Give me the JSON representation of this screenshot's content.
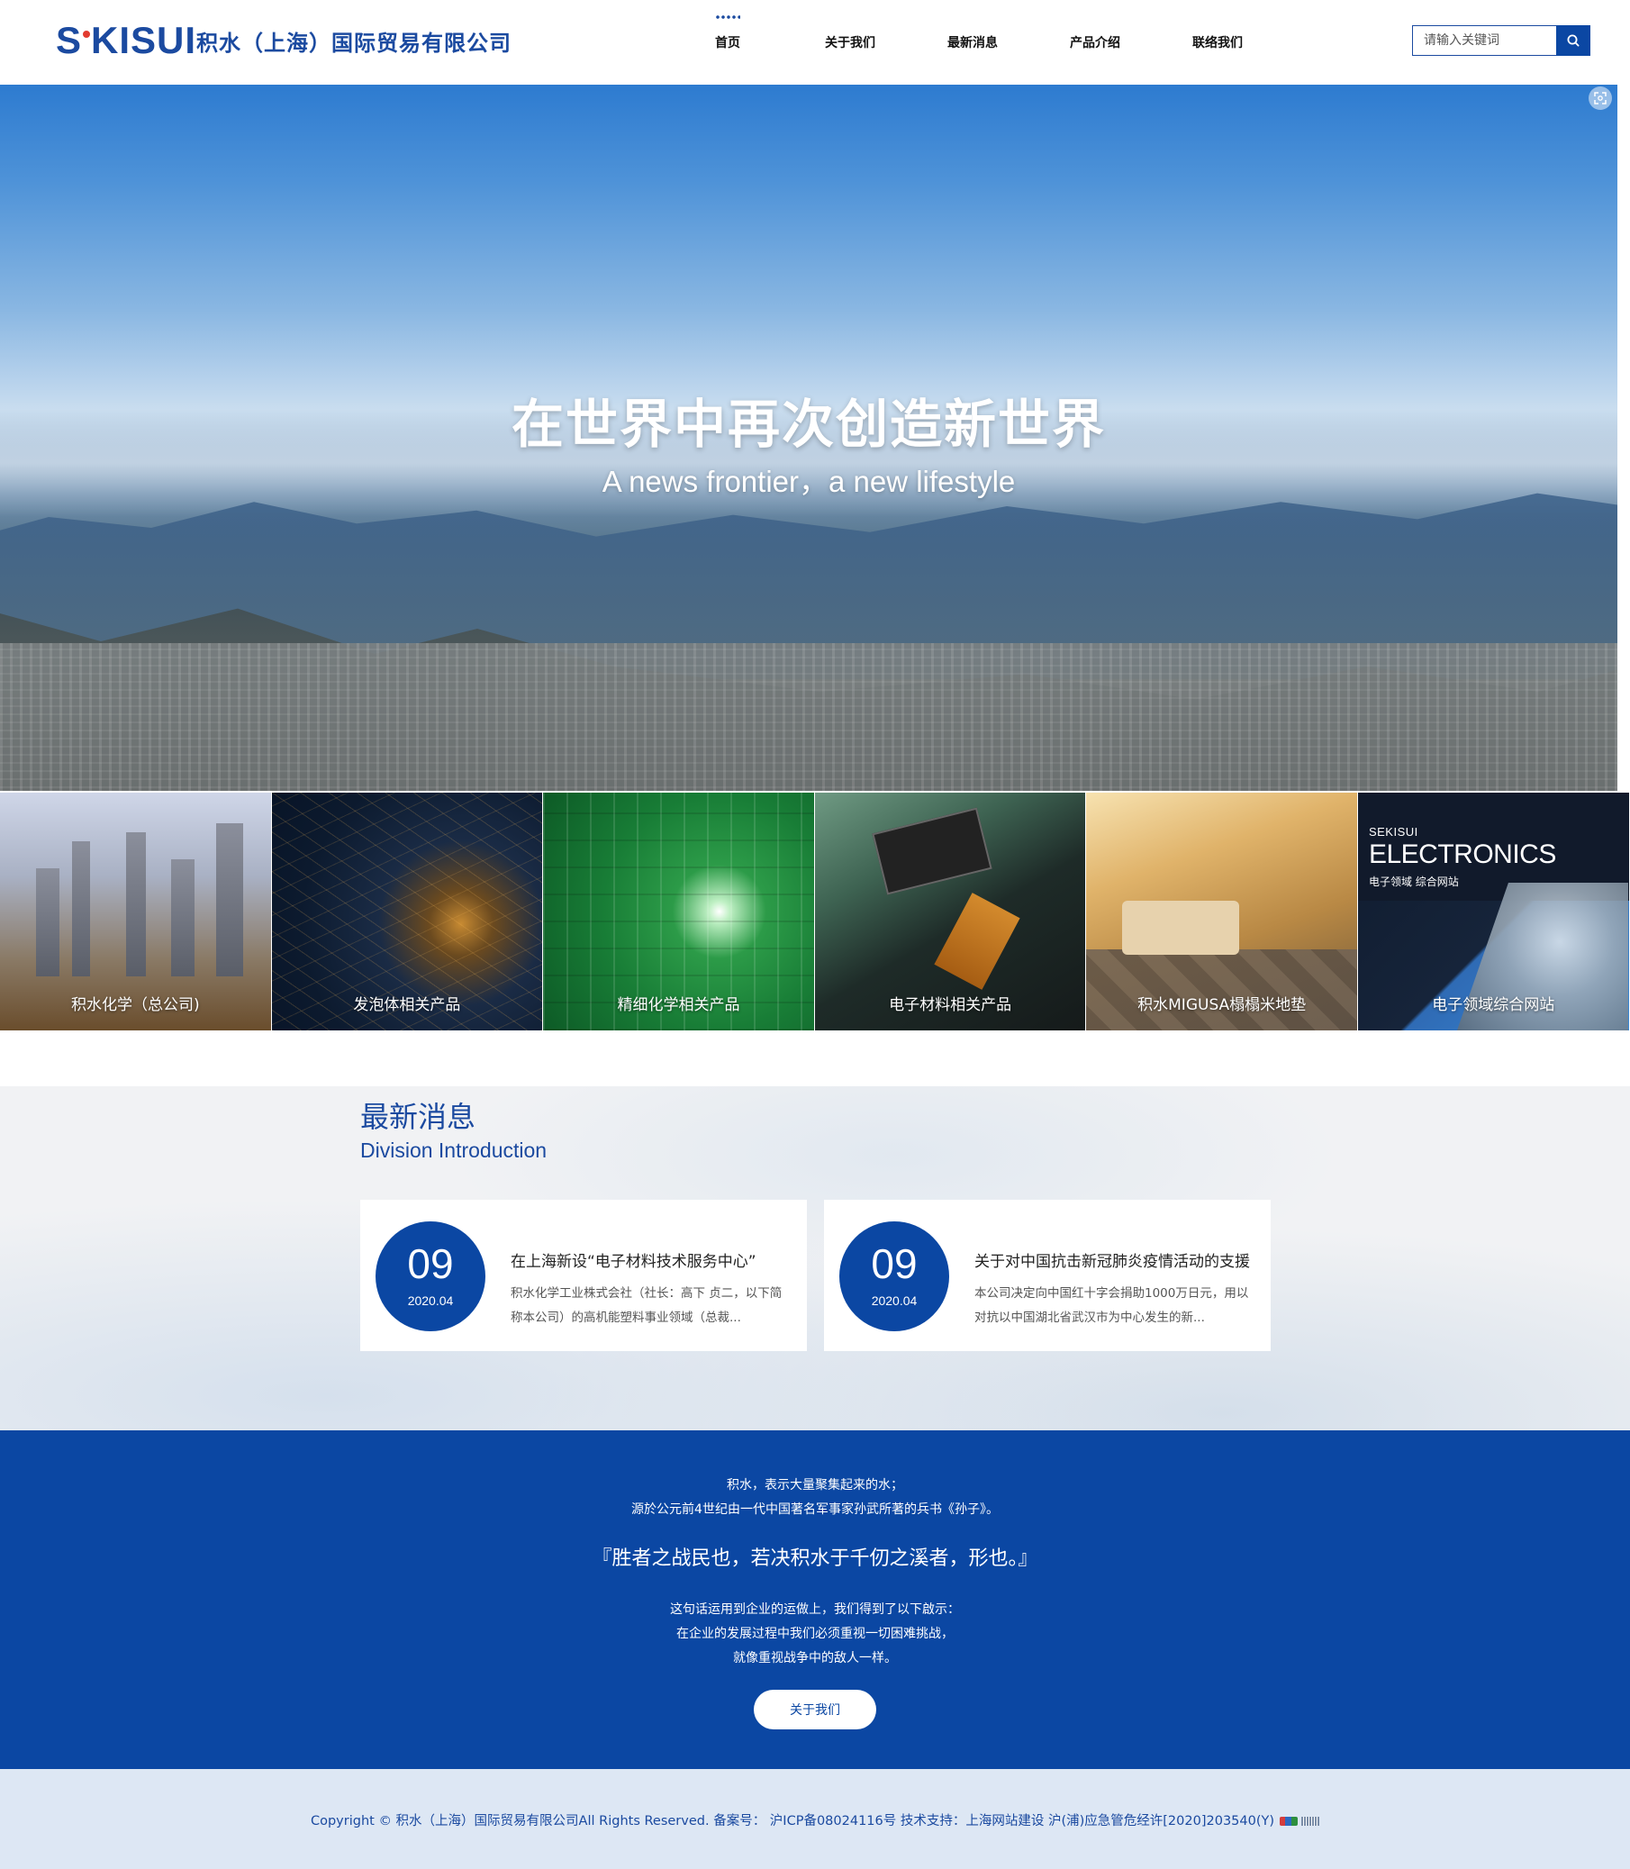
{
  "header": {
    "logo_text": "SEKISUI",
    "company_name": "积水（上海）国际贸易有限公司",
    "nav": [
      {
        "label": "首页"
      },
      {
        "label": "关于我们"
      },
      {
        "label": "最新消息"
      },
      {
        "label": "产品介绍"
      },
      {
        "label": "联络我们"
      }
    ],
    "search_placeholder": "请输入关键词"
  },
  "hero": {
    "title": "在世界中再次创造新世界",
    "subtitle": "A news frontier，a new lifestyle"
  },
  "tiles": [
    {
      "label": "积水化学（总公司)"
    },
    {
      "label": "发泡体相关产品"
    },
    {
      "label": "精细化学相关产品"
    },
    {
      "label": "电子材料相关产品"
    },
    {
      "label": "积水MIGUSA榻榻米地垫"
    },
    {
      "label": "电子领域综合网站",
      "brand_small": "SEKISUI",
      "brand_large": "ELECTRONICS",
      "brand_cn": "电子领域  综合网站"
    }
  ],
  "news": {
    "title": "最新消息",
    "subtitle": "Division Introduction",
    "items": [
      {
        "day": "09",
        "month": "2020.04",
        "title": "在上海新设“电子材料技术服务中心”",
        "desc": "积水化学工业株式会社（社长：高下 贞二，以下简称本公司）的高机能塑料事业领域（总裁..."
      },
      {
        "day": "09",
        "month": "2020.04",
        "title": "关于对中国抗击新冠肺炎疫情活动的支援",
        "desc": "本公司决定向中国红十字会捐助1000万日元，用以对抗以中国湖北省武汉市为中心发生的新..."
      }
    ]
  },
  "quote": {
    "line1": "积水，表示大量聚集起来的水；",
    "line2": "源於公元前4世纪由一代中国著名军事家孙武所著的兵书《孙子》。",
    "big": "『胜者之战民也，若决积水于千仞之溪者，形也。』",
    "line3": "这句话运用到企业的运做上，我们得到了以下啟示：",
    "line4": "在企业的发展过程中我们必须重视一切困难挑战，",
    "line5": "就像重视战争中的敌人一样。",
    "button": "关于我们"
  },
  "footer": {
    "copyright": "Copyright © 积水（上海）国际贸易有限公司All Rights Reserved. 备案号： 沪ICP备08024116号 技术支持：上海网站建设 沪(浦)应急管危经许[2020]203540(Y)"
  },
  "colors": {
    "brand_blue": "#0b47a3",
    "logo_blue": "#1b4aa0",
    "footer_bg": "#dde7f4"
  },
  "icons": {
    "search": "search-icon",
    "fullscreen": "fullscreen-icon"
  }
}
